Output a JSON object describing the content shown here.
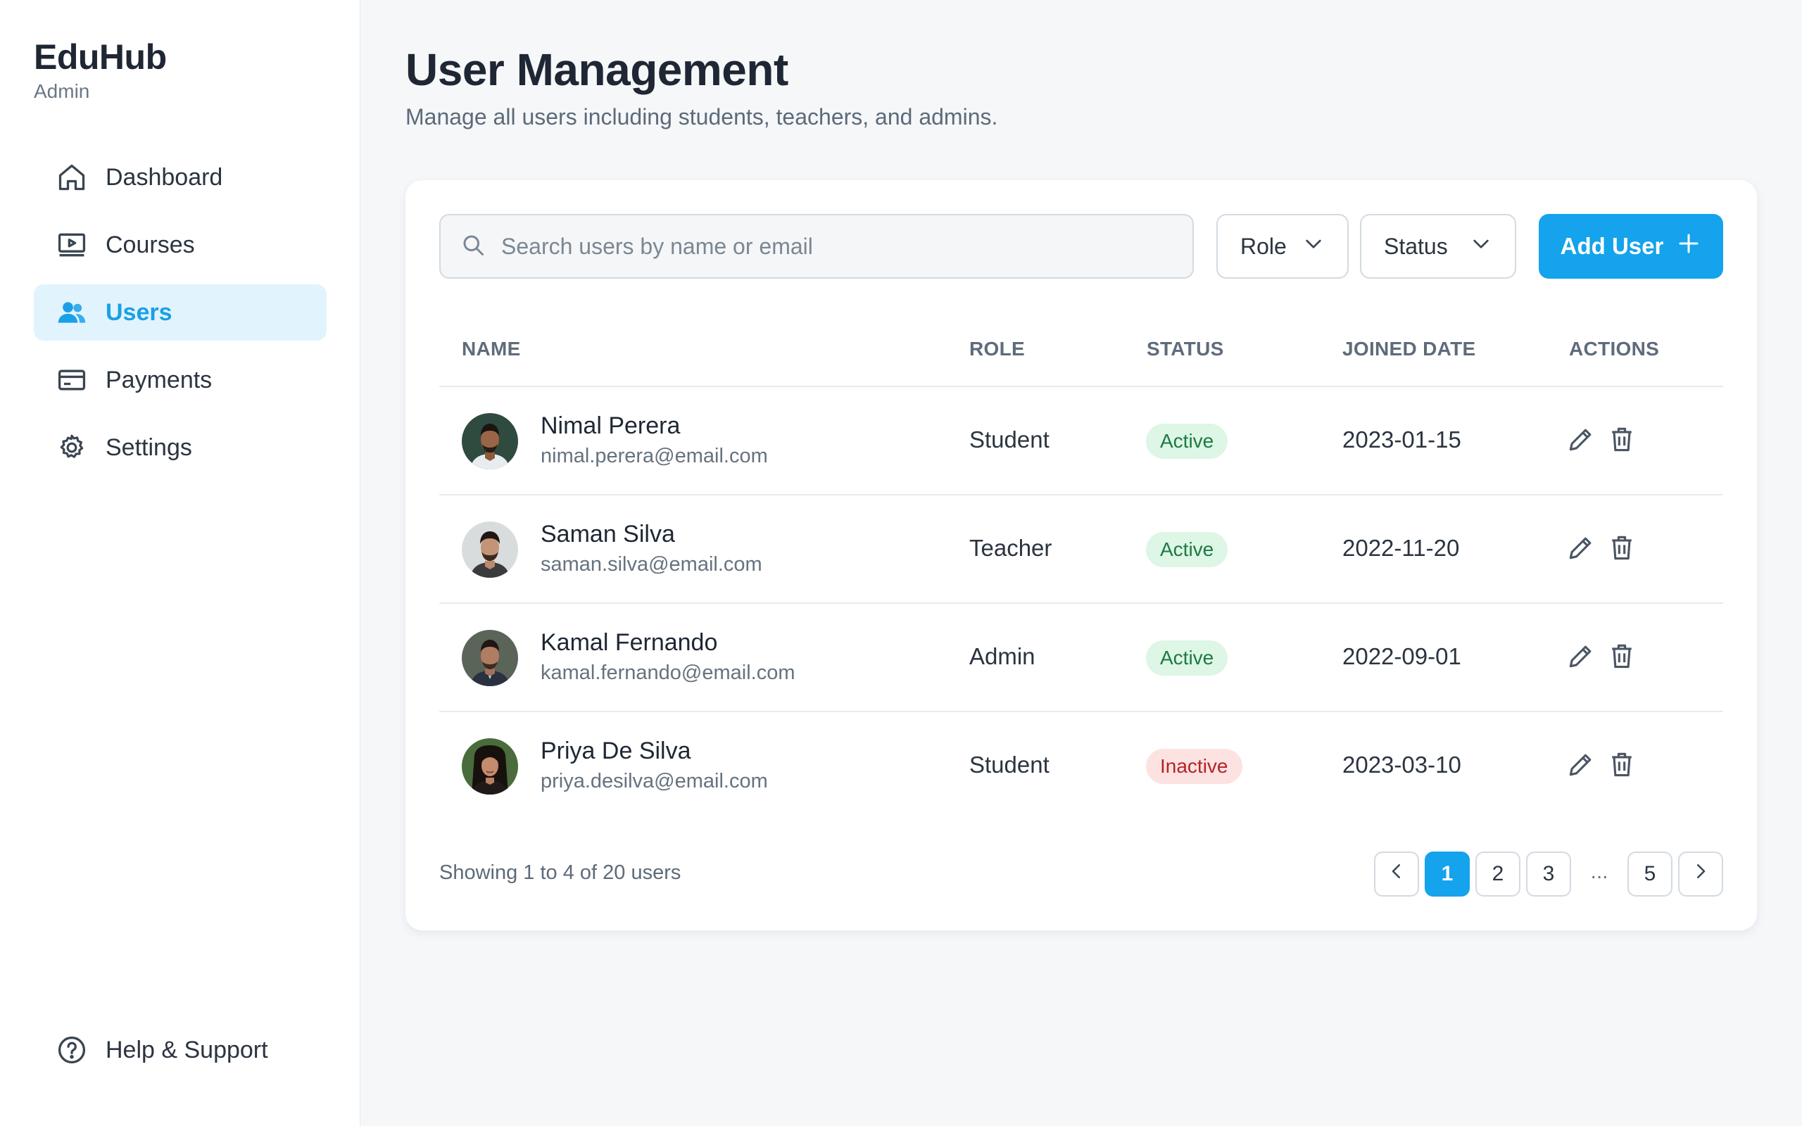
{
  "sidebar": {
    "brand": "EduHub",
    "brand_sub": "Admin",
    "items": [
      {
        "label": "Dashboard",
        "icon": "home-icon",
        "active": false
      },
      {
        "label": "Courses",
        "icon": "video-lesson-icon",
        "active": false
      },
      {
        "label": "Users",
        "icon": "users-icon",
        "active": true
      },
      {
        "label": "Payments",
        "icon": "credit-card-icon",
        "active": false
      },
      {
        "label": "Settings",
        "icon": "gear-icon",
        "active": false
      }
    ],
    "help_label": "Help & Support"
  },
  "header": {
    "title": "User Management",
    "subtitle": "Manage all users including students, teachers, and admins."
  },
  "toolbar": {
    "search_placeholder": "Search users by name or email",
    "role_filter": "Role",
    "status_filter": "Status",
    "add_label": "Add User"
  },
  "table": {
    "columns": [
      "NAME",
      "ROLE",
      "STATUS",
      "JOINED DATE",
      "ACTIONS"
    ],
    "rows": [
      {
        "name": "Nimal Perera",
        "email": "nimal.perera@email.com",
        "role": "Student",
        "status": "Active",
        "joined": "2023-01-15"
      },
      {
        "name": "Saman Silva",
        "email": "saman.silva@email.com",
        "role": "Teacher",
        "status": "Active",
        "joined": "2022-11-20"
      },
      {
        "name": "Kamal Fernando",
        "email": "kamal.fernando@email.com",
        "role": "Admin",
        "status": "Active",
        "joined": "2022-09-01"
      },
      {
        "name": "Priya De Silva",
        "email": "priya.desilva@email.com",
        "role": "Student",
        "status": "Inactive",
        "joined": "2023-03-10"
      }
    ]
  },
  "pagination": {
    "summary": "Showing 1 to 4 of 20 users",
    "pages": [
      "1",
      "2",
      "3",
      "...",
      "5"
    ],
    "current": "1"
  },
  "colors": {
    "accent": "#14a3ec",
    "active_nav_bg": "#e1f3fd",
    "badge_active_bg": "#ddf6e6",
    "badge_active_text": "#1d7a42",
    "badge_inactive_bg": "#fde2e2",
    "badge_inactive_text": "#b42424"
  }
}
